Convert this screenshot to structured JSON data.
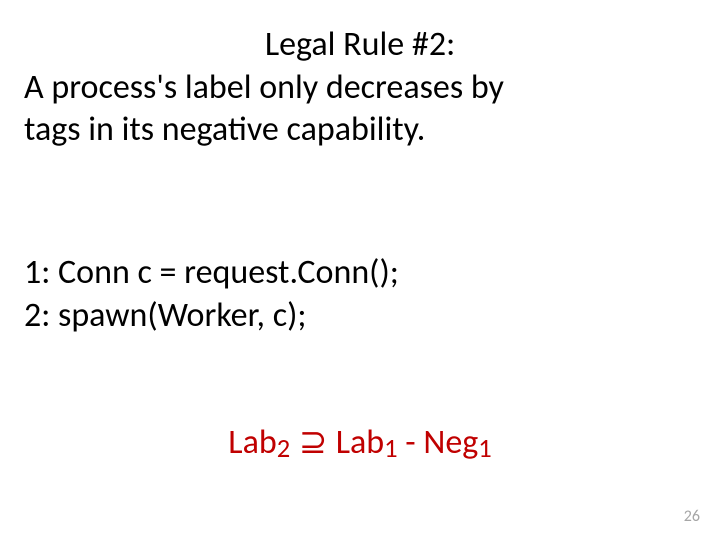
{
  "rule": {
    "title": "Legal Rule #2:",
    "line1": "A process's label only decreases by",
    "line2": "tags in its negative capability."
  },
  "code": {
    "line1": "1:  Conn c = request.Conn();",
    "line2": "2:  spawn(Worker, c);"
  },
  "formula": {
    "lab_a_name": "Lab",
    "lab_a_sub": "2",
    "superset": " ⊇ ",
    "lab_b_name": "Lab",
    "lab_b_sub": "1",
    "minus": "  -  ",
    "neg_name": "Neg",
    "neg_sub": "1"
  },
  "page": "26"
}
